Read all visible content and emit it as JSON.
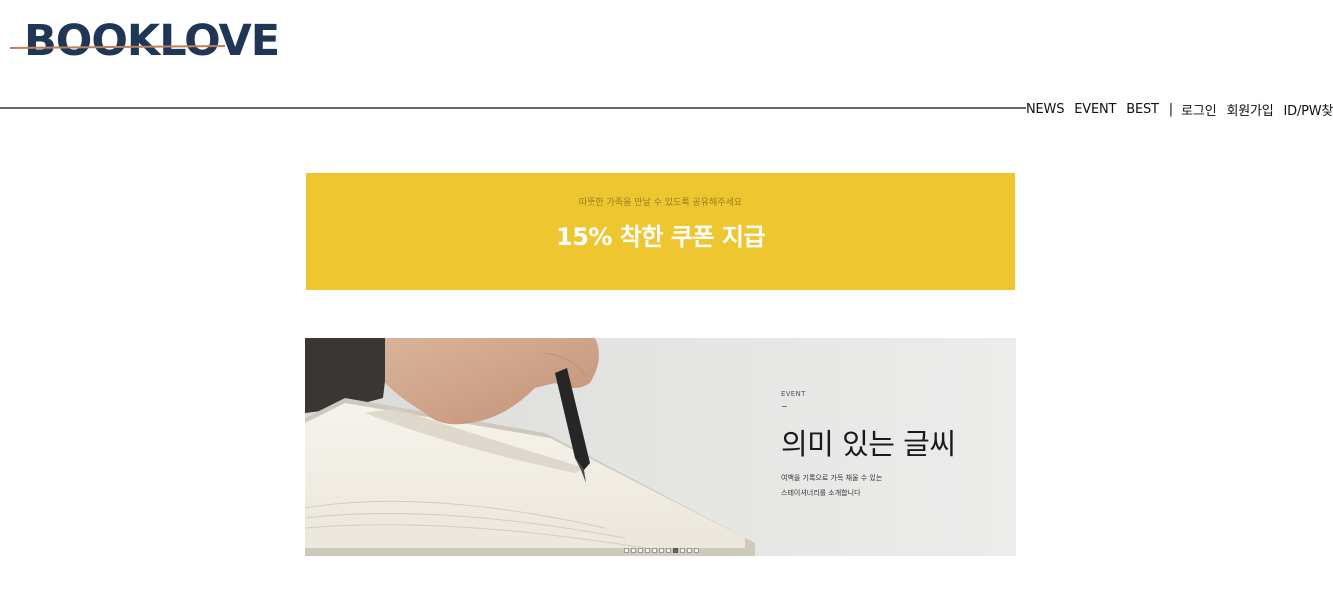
{
  "logo": {
    "text": "BOOKLOVE",
    "color": "#1f3657",
    "strike_color": "#c0805a"
  },
  "nav": {
    "items": [
      "NEWS",
      "EVENT",
      "BEST"
    ],
    "separator": "|",
    "account": [
      "로그인",
      "회원가입",
      "ID/PW찾기"
    ]
  },
  "coupon_banner": {
    "subtitle": "따뜻한 가족을 만날 수 있도록 공유해주세요",
    "title": "15% 착한 쿠폰 지급",
    "bg_color": "#eec630"
  },
  "event_slide": {
    "tag": "EVENT",
    "title": "의미 있는 글씨",
    "desc_line1": "여백을 기록으로 가득 채울 수 있는",
    "desc_line2": "스테이셔너리를 소개합니다",
    "dots_total": 11,
    "active_dot": 8
  }
}
